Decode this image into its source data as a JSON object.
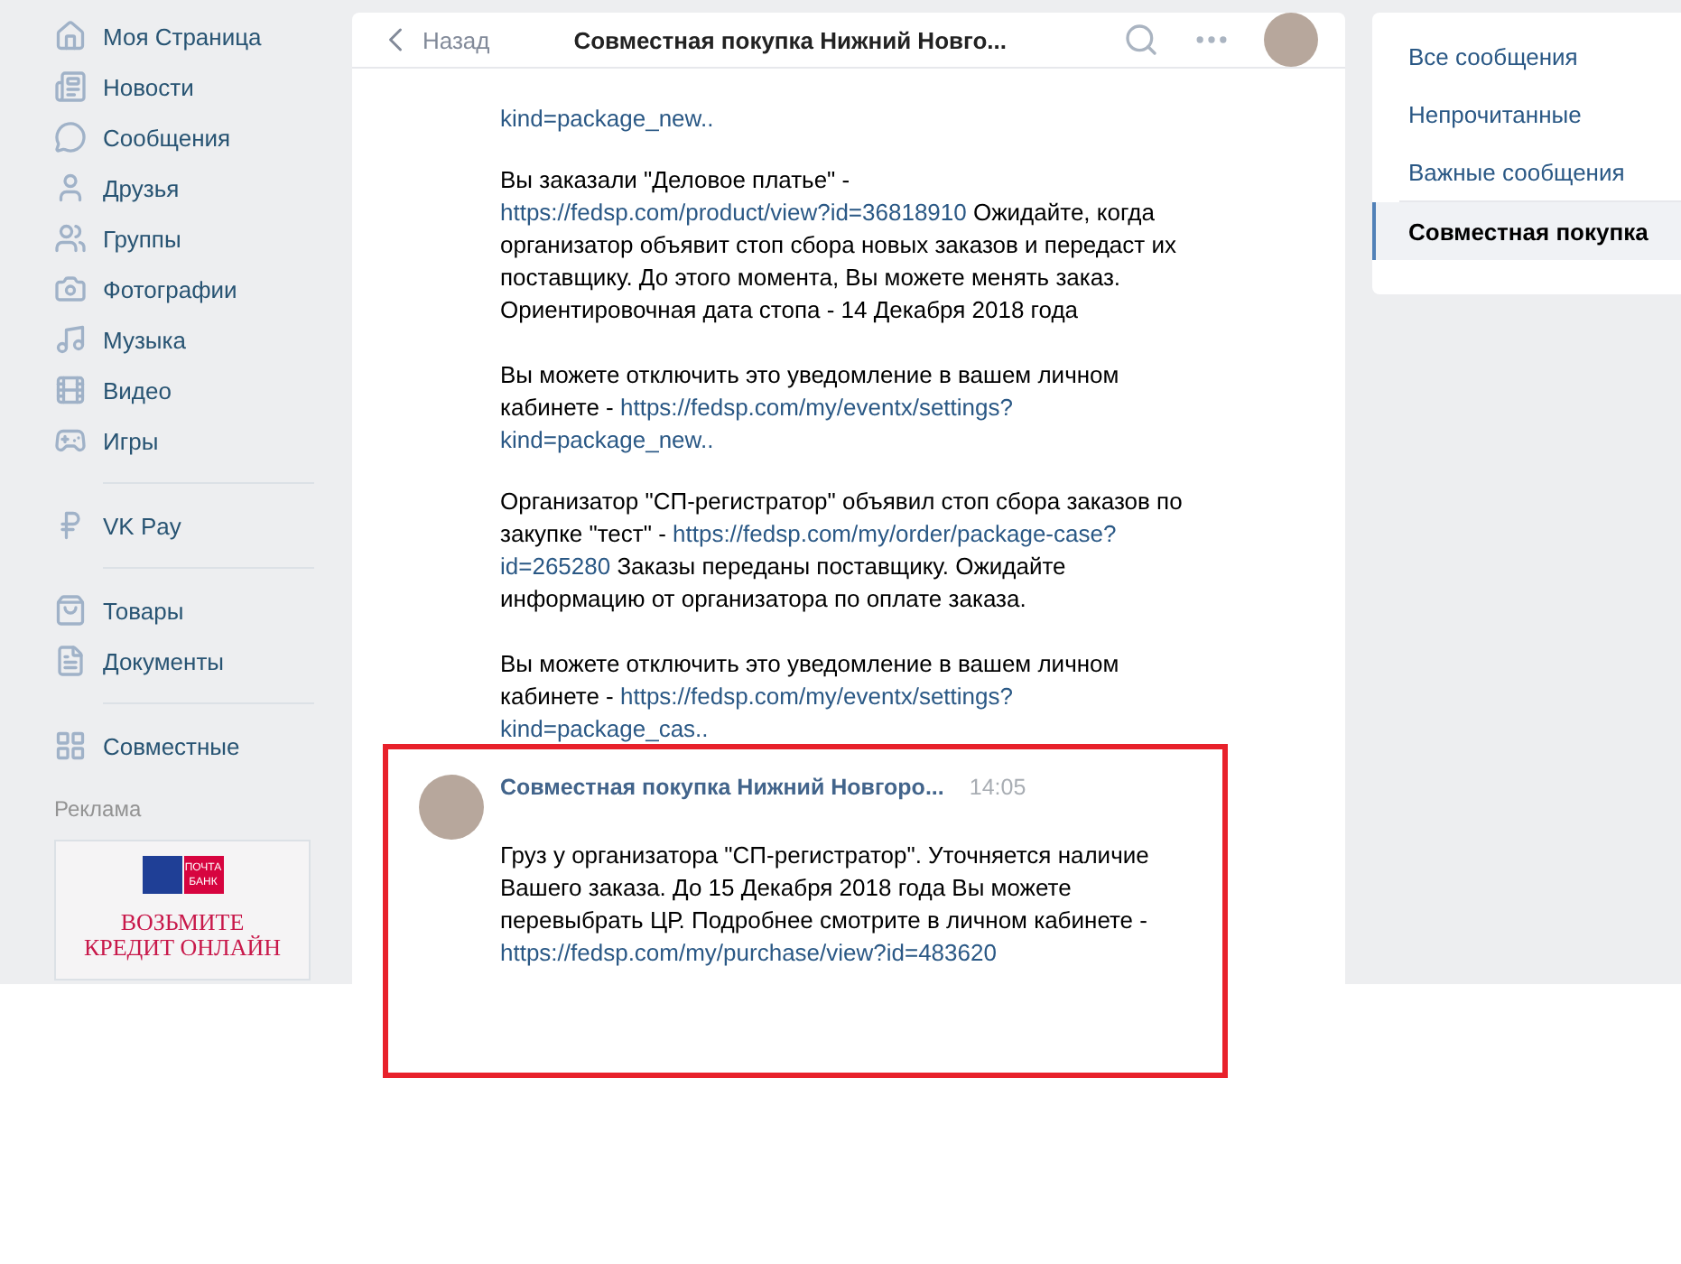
{
  "sidebar": {
    "groups": [
      {
        "items": [
          {
            "kind": "home",
            "label": "Моя Страница"
          },
          {
            "kind": "news",
            "label": "Новости"
          },
          {
            "kind": "messages",
            "label": "Сообщения"
          },
          {
            "kind": "friends",
            "label": "Друзья"
          },
          {
            "kind": "groups",
            "label": "Группы"
          },
          {
            "kind": "photos",
            "label": "Фотографии"
          },
          {
            "kind": "music",
            "label": "Музыка"
          },
          {
            "kind": "video",
            "label": "Видео"
          },
          {
            "kind": "games",
            "label": "Игры"
          }
        ]
      },
      {
        "items": [
          {
            "kind": "pay",
            "label": "VK Pay"
          }
        ]
      },
      {
        "items": [
          {
            "kind": "goods",
            "label": "Товары"
          },
          {
            "kind": "docs",
            "label": "Документы"
          }
        ]
      },
      {
        "items": [
          {
            "kind": "apps",
            "label": "Совместные"
          }
        ]
      }
    ],
    "ad": {
      "label": "Реклама",
      "logo": "ПОЧТА БАНК",
      "headline": [
        "ВОЗЬМИТЕ",
        "КРЕДИТ ОНЛАЙН"
      ]
    }
  },
  "chat": {
    "back": "Назад",
    "title": "Совместная покупка Нижний Новго...",
    "messages": [
      {
        "paragraphs": [
          [
            [
              {
                "kind": "link",
                "text": "kind=package_new.."
              }
            ]
          ]
        ]
      },
      {
        "paragraphs": [
          [
            [
              {
                "kind": "text",
                "text": "Вы заказали \"Деловое платье\" -"
              }
            ],
            [
              {
                "kind": "link",
                "text": "https://fedsp.com/product/view?id=36818910"
              },
              {
                "kind": "text",
                "text": " Ожидайте, когда"
              }
            ],
            [
              {
                "kind": "text",
                "text": "организатор объявит стоп сбора новых заказов и передаст их"
              }
            ],
            [
              {
                "kind": "text",
                "text": "поставщику. До этого момента, Вы можете менять заказ."
              }
            ],
            [
              {
                "kind": "text",
                "text": "Ориентировочная дата стопа - 14 Декабря 2018 года"
              }
            ]
          ],
          [
            [
              {
                "kind": "text",
                "text": "Вы можете отключить это уведомление в вашем личном"
              }
            ],
            [
              {
                "kind": "text",
                "text": "кабинете - "
              },
              {
                "kind": "link",
                "text": "https://fedsp.com/my/eventx/settings?"
              }
            ],
            [
              {
                "kind": "link",
                "text": "kind=package_new.."
              }
            ]
          ]
        ]
      },
      {
        "paragraphs": [
          [
            [
              {
                "kind": "text",
                "text": "Организатор \"СП-регистратор\" объявил стоп сбора заказов по"
              }
            ],
            [
              {
                "kind": "text",
                "text": "закупке \"тест\" - "
              },
              {
                "kind": "link",
                "text": "https://fedsp.com/my/order/package-case?"
              }
            ],
            [
              {
                "kind": "link",
                "text": "id=265280"
              },
              {
                "kind": "text",
                "text": " Заказы переданы поставщику. Ожидайте"
              }
            ],
            [
              {
                "kind": "text",
                "text": "информацию от организатора по оплате заказа."
              }
            ]
          ],
          [
            [
              {
                "kind": "text",
                "text": "Вы можете отключить это уведомление в вашем личном"
              }
            ],
            [
              {
                "kind": "text",
                "text": "кабинете - "
              },
              {
                "kind": "link",
                "text": "https://fedsp.com/my/eventx/settings?"
              }
            ],
            [
              {
                "kind": "link",
                "text": "kind=package_cas.."
              }
            ]
          ]
        ]
      },
      {
        "author": "Совместная покупка Нижний Новгоро...",
        "time": "14:05",
        "paragraphs": [
          [
            [
              {
                "kind": "text",
                "text": "Груз у организатора \"СП-регистратор\". Уточняется наличие"
              }
            ],
            [
              {
                "kind": "text",
                "text": "Вашего заказа. До 15 Декабря 2018 года Вы можете"
              }
            ],
            [
              {
                "kind": "text",
                "text": "перевыбрать ЦР. Подробнее смотрите в личном кабинете -"
              }
            ],
            [
              {
                "kind": "link",
                "text": "https://fedsp.com/my/purchase/view?id=483620"
              }
            ]
          ]
        ]
      }
    ]
  },
  "filters": [
    {
      "label": "Все сообщения",
      "selected": false
    },
    {
      "label": "Непрочитанные",
      "selected": false
    },
    {
      "label": "Важные сообщения",
      "selected": false
    },
    {
      "label": "Совместная покупка",
      "selected": true
    }
  ]
}
